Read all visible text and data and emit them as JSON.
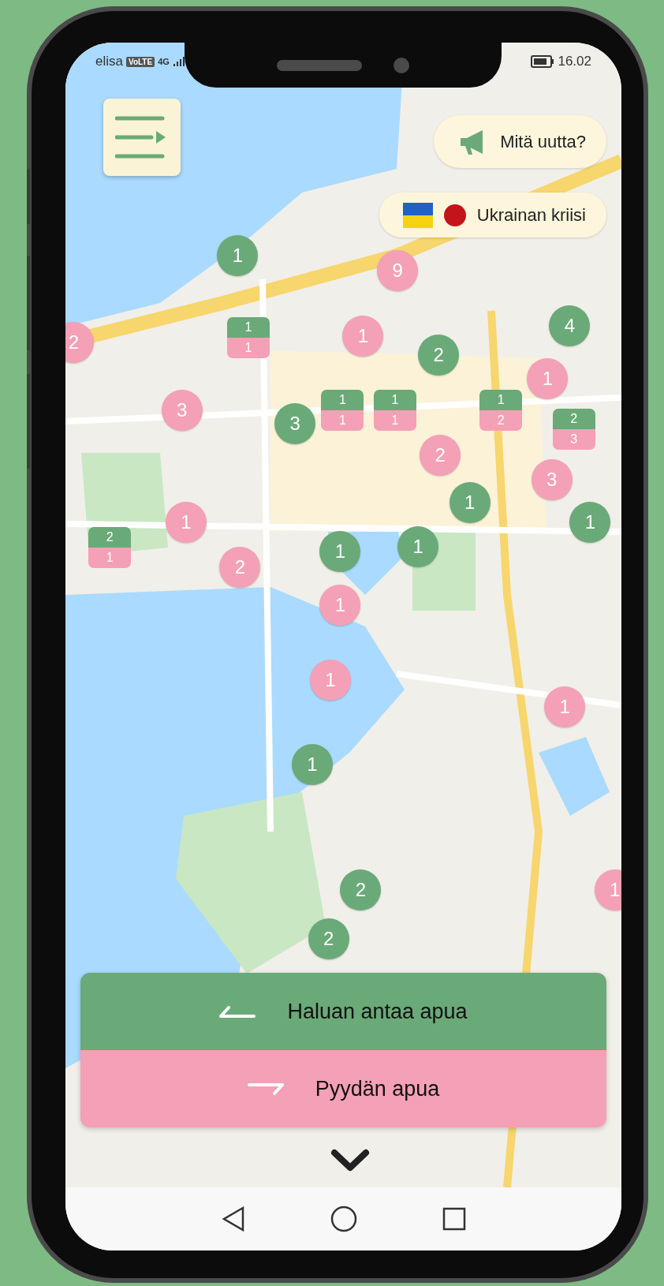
{
  "status_bar": {
    "carrier": "elisa",
    "network_badge": "VoLTE",
    "network_type": "4G",
    "time": "16.02"
  },
  "header": {
    "news_button": {
      "label": "Mitä uutta?"
    },
    "crisis_button": {
      "label": "Ukrainan kriisi"
    }
  },
  "markers": [
    {
      "kind": "offer",
      "count": "1"
    },
    {
      "kind": "request",
      "count": "9"
    },
    {
      "kind": "request",
      "count": "2"
    },
    {
      "kind": "mixed",
      "offers": "1",
      "requests": "1"
    },
    {
      "kind": "request",
      "count": "1"
    },
    {
      "kind": "offer",
      "count": "2"
    },
    {
      "kind": "offer",
      "count": "4"
    },
    {
      "kind": "request",
      "count": "1"
    },
    {
      "kind": "request",
      "count": "3"
    },
    {
      "kind": "offer",
      "count": "3"
    },
    {
      "kind": "mixed",
      "offers": "1",
      "requests": "1"
    },
    {
      "kind": "mixed",
      "offers": "1",
      "requests": "1"
    },
    {
      "kind": "mixed",
      "offers": "1",
      "requests": "2"
    },
    {
      "kind": "mixed",
      "offers": "2",
      "requests": "3"
    },
    {
      "kind": "request",
      "count": "2"
    },
    {
      "kind": "request",
      "count": "3"
    },
    {
      "kind": "offer",
      "count": "1"
    },
    {
      "kind": "offer",
      "count": "1"
    },
    {
      "kind": "request",
      "count": "1"
    },
    {
      "kind": "mixed",
      "offers": "2",
      "requests": "1"
    },
    {
      "kind": "request",
      "count": "2"
    },
    {
      "kind": "offer",
      "count": "1"
    },
    {
      "kind": "offer",
      "count": "1"
    },
    {
      "kind": "request",
      "count": "1"
    },
    {
      "kind": "request",
      "count": "1"
    },
    {
      "kind": "request",
      "count": "1"
    },
    {
      "kind": "offer",
      "count": "1"
    },
    {
      "kind": "offer",
      "count": "2"
    },
    {
      "kind": "offer",
      "count": "2"
    },
    {
      "kind": "request",
      "count": "1"
    }
  ],
  "actions": [
    {
      "kind": "offer",
      "label": "Haluan antaa apua"
    },
    {
      "kind": "request",
      "label": "Pyydän apua"
    }
  ]
}
